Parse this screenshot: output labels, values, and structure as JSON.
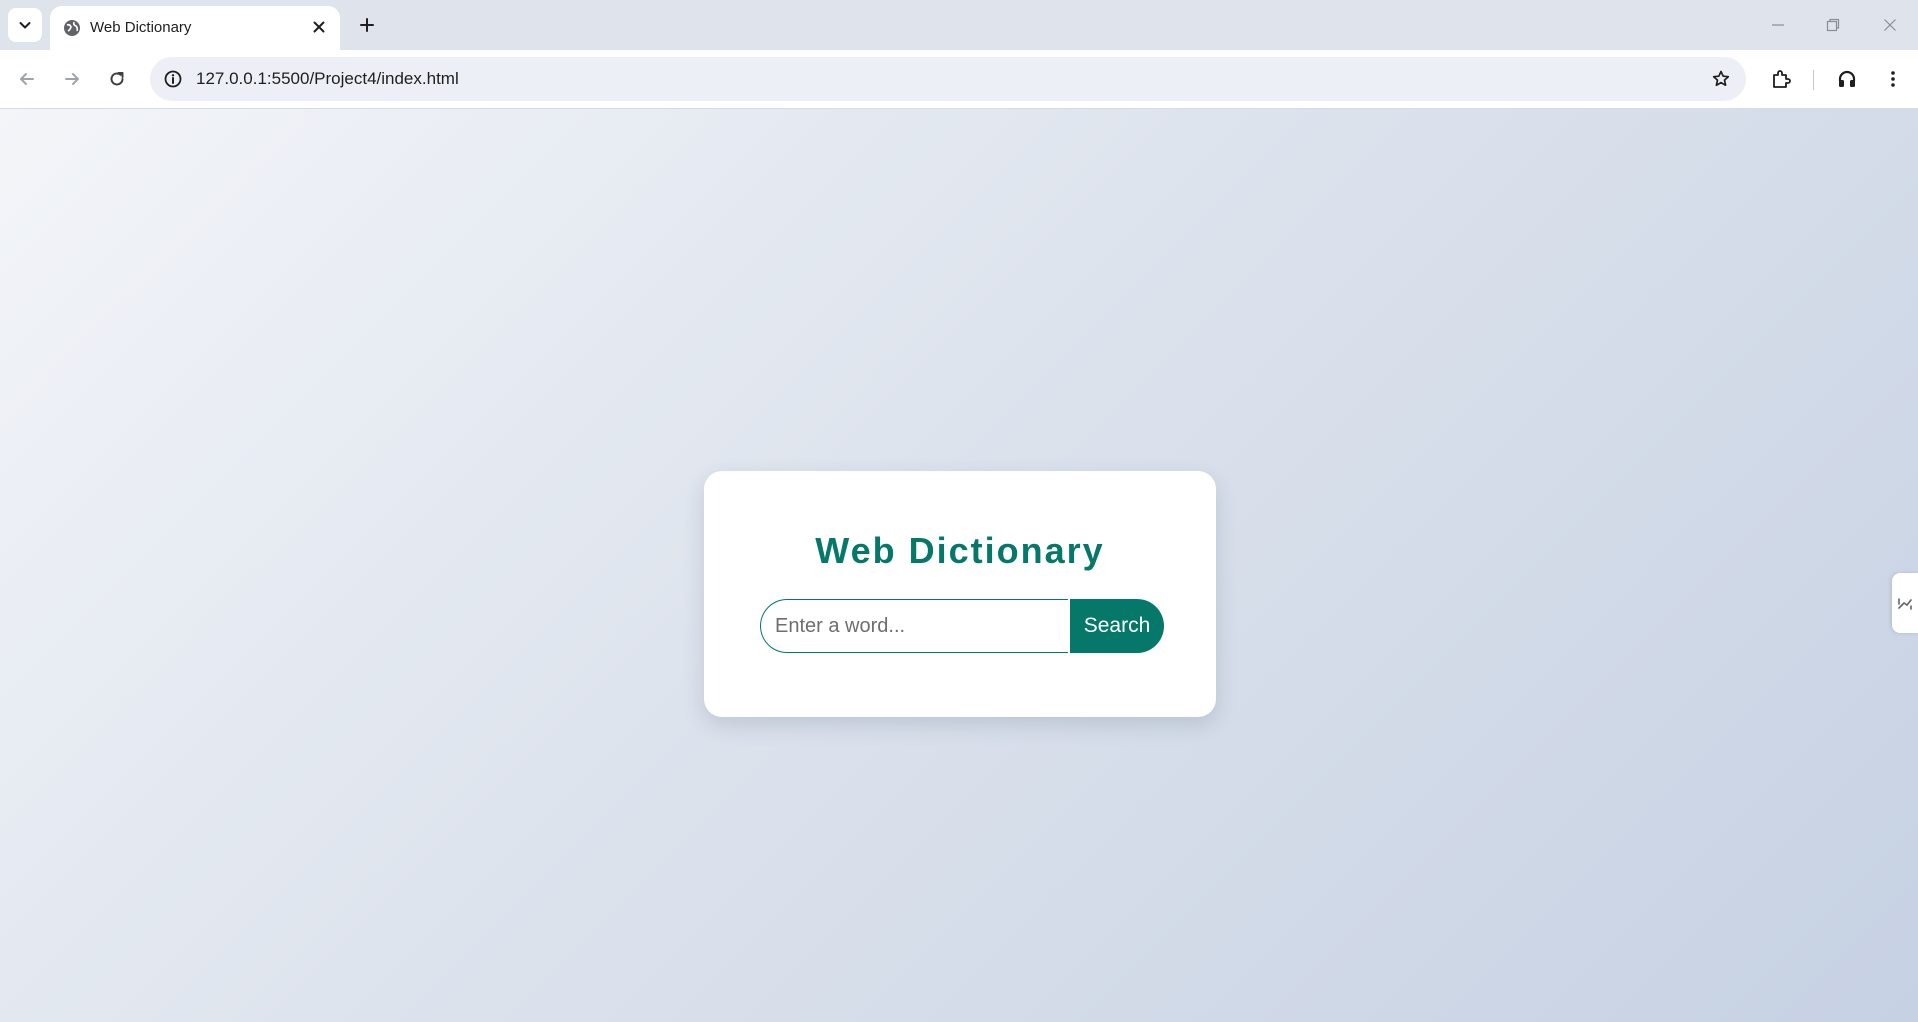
{
  "browser": {
    "tab": {
      "title": "Web Dictionary",
      "favicon": "globe-icon"
    },
    "address_bar": {
      "url": "127.0.0.1:5500/Project4/index.html"
    },
    "icons": [
      "chevron-down-icon",
      "close-icon",
      "plus-icon",
      "minimize-icon",
      "restore-icon",
      "back-arrow-icon",
      "forward-arrow-icon",
      "reload-icon",
      "site-info-icon",
      "star-icon",
      "extensions-icon",
      "headphones-icon",
      "more-vert-icon",
      "sidebar-toggle-icon"
    ]
  },
  "page": {
    "title": "Web Dictionary",
    "search": {
      "placeholder": "Enter a word...",
      "value": "",
      "button_label": "Search"
    }
  },
  "colors": {
    "accent": "#06786a",
    "card_background": "#ffffff",
    "tabstrip": "#dfe3eb",
    "omnibox": "#eceff5"
  }
}
